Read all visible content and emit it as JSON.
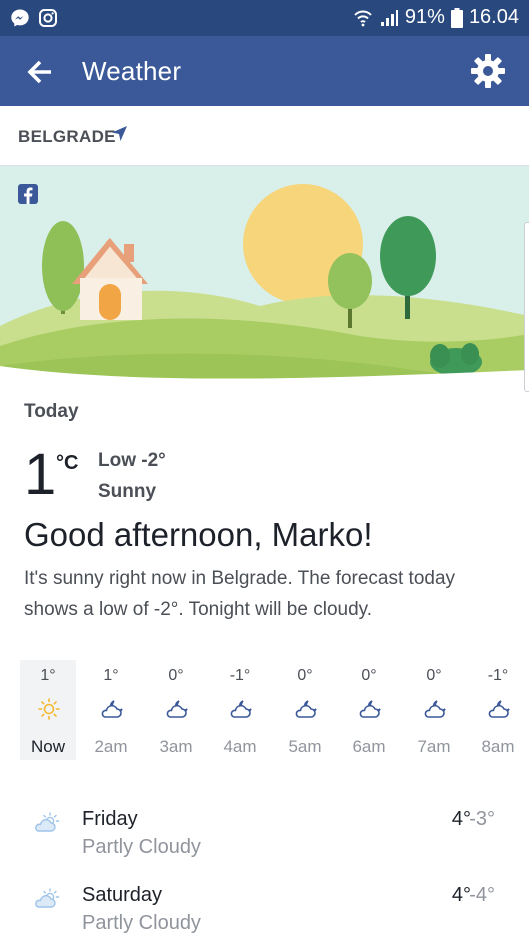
{
  "status_bar": {
    "battery": "91%",
    "time": "16.04",
    "icons": [
      "messenger-icon",
      "instagram-icon",
      "wifi-icon",
      "signal-icon",
      "battery-icon"
    ]
  },
  "app_bar": {
    "title": "Weather",
    "back_icon": "arrow-left-icon",
    "settings_icon": "gear-icon"
  },
  "location": {
    "name": "BELGRADE",
    "icon": "location-arrow-icon"
  },
  "colors": {
    "app_bar": "#3b5998",
    "status_bar": "#29487d",
    "sky": "#d9efe9",
    "sun": "#f7d57b",
    "hills": "#b9d67a"
  },
  "today": {
    "label": "Today",
    "temperature": "1",
    "unit": "°C",
    "low": "Low -2°",
    "condition": "Sunny",
    "greeting": "Good afternoon, Marko!",
    "summary": "It's sunny right now in Belgrade. The forecast today shows a low of -2°. Tonight will be cloudy."
  },
  "hourly": [
    {
      "temp": "1°",
      "icon": "sun-icon",
      "label": "Now",
      "active": true
    },
    {
      "temp": "1°",
      "icon": "moon-cloud-icon",
      "label": "2am"
    },
    {
      "temp": "0°",
      "icon": "moon-cloud-icon",
      "label": "3am"
    },
    {
      "temp": "-1°",
      "icon": "moon-cloud-icon",
      "label": "4am"
    },
    {
      "temp": "0°",
      "icon": "moon-cloud-icon",
      "label": "5am"
    },
    {
      "temp": "0°",
      "icon": "moon-cloud-icon",
      "label": "6am"
    },
    {
      "temp": "0°",
      "icon": "moon-cloud-icon",
      "label": "7am"
    },
    {
      "temp": "-1°",
      "icon": "moon-cloud-icon",
      "label": "8am"
    }
  ],
  "daily": [
    {
      "day": "Friday",
      "condition": "Partly Cloudy",
      "high": "4°",
      "low": "-3°",
      "icon": "partly-cloudy-icon"
    },
    {
      "day": "Saturday",
      "condition": "Partly Cloudy",
      "high": "4°",
      "low": "-4°",
      "icon": "partly-cloudy-icon"
    }
  ]
}
